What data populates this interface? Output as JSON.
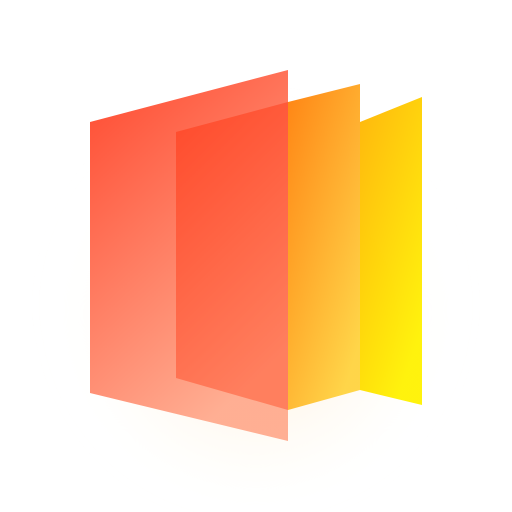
{
  "icon": {
    "name": "layered-panels-logo",
    "colors": {
      "background": "#ffffff",
      "glow": "#ffe9c4",
      "back_panel_top": "#ffb300",
      "back_panel_bottom": "#fff200",
      "middle_panel_top": "#ff7a00",
      "middle_panel_bottom": "#ffd23a",
      "front_panel_top": "#ff3b1f",
      "front_panel_bottom": "#ffa98c",
      "overlap_tint": "#ff2a10"
    }
  }
}
